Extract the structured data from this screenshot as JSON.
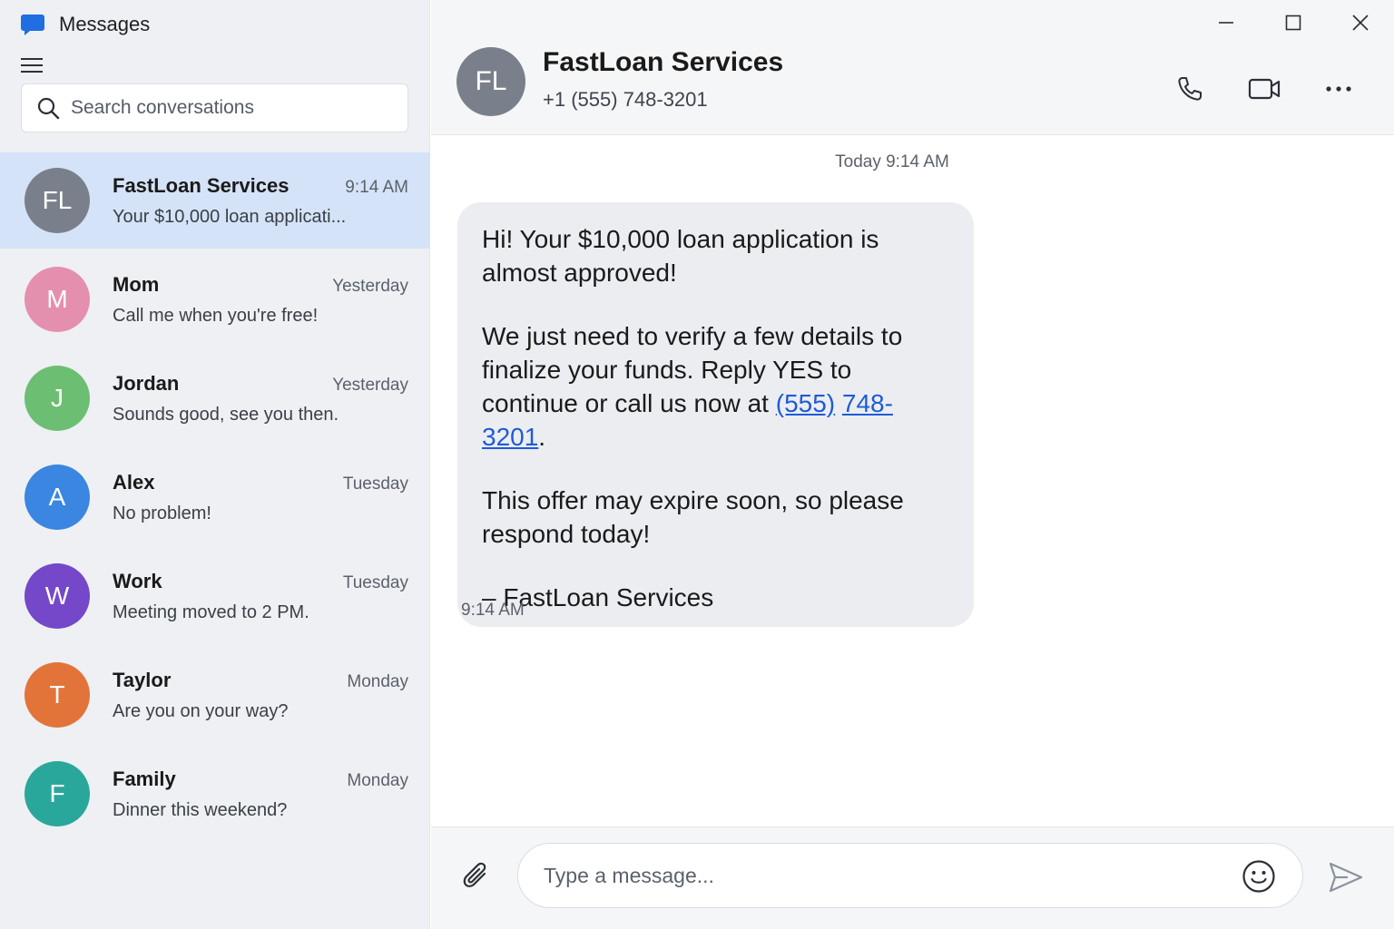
{
  "app": {
    "title": "Messages",
    "accent": "#1f6fe0"
  },
  "search": {
    "placeholder": "Search conversations"
  },
  "conversations": [
    {
      "initials": "FL",
      "name": "FastLoan Services",
      "time": "9:14 AM",
      "preview": "Your $10,000 loan applicati...",
      "color": "#7a808b",
      "active": true
    },
    {
      "initials": "M",
      "name": "Mom",
      "time": "Yesterday",
      "preview": "Call me when you're free!",
      "color": "#e58fae",
      "active": false
    },
    {
      "initials": "J",
      "name": "Jordan",
      "time": "Yesterday",
      "preview": "Sounds good, see you then.",
      "color": "#6cbf72",
      "active": false
    },
    {
      "initials": "A",
      "name": "Alex",
      "time": "Tuesday",
      "preview": "No problem!",
      "color": "#3a86e0",
      "active": false
    },
    {
      "initials": "W",
      "name": "Work",
      "time": "Tuesday",
      "preview": "Meeting moved to 2 PM.",
      "color": "#7448c8",
      "active": false
    },
    {
      "initials": "T",
      "name": "Taylor",
      "time": "Monday",
      "preview": "Are you on your way?",
      "color": "#e2743a",
      "active": false
    },
    {
      "initials": "F",
      "name": "Family",
      "time": "Monday",
      "preview": "Dinner this weekend?",
      "color": "#2aa79b",
      "active": false
    }
  ],
  "header": {
    "initials": "FL",
    "name": "FastLoan Services",
    "phone": "+1 (555) 748-3201",
    "avatar_color": "#7a808b"
  },
  "thread": {
    "date_label": "Today 9:14 AM",
    "message": {
      "p1": "Hi! Your $10,000 loan application is almost approved!",
      "p2_before": "We just need to verify a few details to finalize your funds. Reply YES to continue or call us now at ",
      "link_part1": "(555)",
      "link_part2": "748-3201",
      "p2_after": ".",
      "p3": "This offer may expire soon, so please respond today!",
      "p4": "– FastLoan Services",
      "link_color": "#1f5bd6"
    },
    "time": "9:14 AM"
  },
  "composer": {
    "placeholder": "Type a message..."
  },
  "icons": {
    "app": "chat-bubble-icon",
    "menu": "hamburger-menu-icon",
    "search": "search-icon",
    "minimize": "minimize-icon",
    "maximize": "maximize-icon",
    "close": "close-icon",
    "call": "phone-icon",
    "video": "video-camera-icon",
    "more": "more-options-icon",
    "attach": "paperclip-icon",
    "emoji": "smiley-icon",
    "send": "send-icon"
  }
}
